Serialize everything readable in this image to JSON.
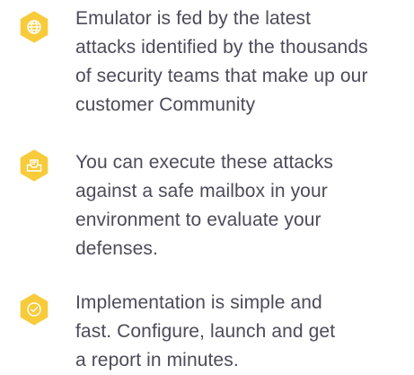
{
  "features": {
    "items": [
      {
        "icon": "globe-icon",
        "text_lines": [
          "Emulator is fed by the latest",
          "attacks identified by the thousands",
          "of security teams that make up our",
          "customer Community"
        ]
      },
      {
        "icon": "mailbox-icon",
        "text_lines": [
          "You can execute these attacks",
          "against a safe mailbox in your",
          "environment to evaluate your",
          "defenses."
        ]
      },
      {
        "icon": "check-circle-icon",
        "text_lines": [
          "Implementation is simple and",
          "fast. Configure, launch and get",
          "a report in minutes."
        ]
      }
    ]
  },
  "colors": {
    "icon_fill": "#f7cb3a",
    "icon_stroke": "#ffffff",
    "text": "#4d4b59"
  }
}
